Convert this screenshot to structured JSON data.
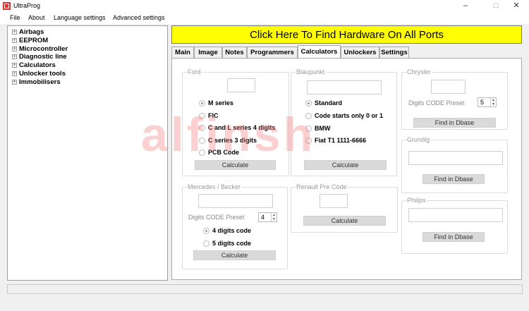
{
  "window": {
    "title": "UltraProg"
  },
  "window_controls": {
    "minimize": "–",
    "maximize": "☐",
    "close": "✕"
  },
  "menu": [
    "File",
    "About",
    "Language settings",
    "Advanced settings"
  ],
  "tree": [
    "Airbags",
    "EEPROM",
    "Microcontroller",
    "Diagnostic line",
    "Calculators",
    "Unlocker tools",
    "Immobilisers"
  ],
  "tree_expander": "+",
  "banner": "Click Here To Find Hardware On All Ports",
  "tabs": [
    "Main",
    "Image",
    "Notes",
    "Programmers",
    "Calculators",
    "Unlockers",
    "Settings"
  ],
  "active_tab": "Calculators",
  "ford": {
    "title": "Ford",
    "options": [
      "M series",
      "FIC",
      "C and L series 4 digits",
      "C series 3 digits",
      "PCB Code"
    ],
    "selected": "M series",
    "button": "Calculate"
  },
  "blaupunkt": {
    "title": "Blaupunkt",
    "options": [
      "Standard",
      "Code starts only 0 or 1",
      "BMW",
      "Fiat T1 1111-6666"
    ],
    "selected": "Standard",
    "button": "Calculate"
  },
  "chrysler": {
    "title": "Chrysler",
    "preset_label": "Digits CODE Preset",
    "preset_value": "5",
    "button": "Find in Dbase"
  },
  "grundig": {
    "title": "Grundig",
    "button": "Find in Dbase"
  },
  "philips": {
    "title": "Philips",
    "button": "Find in Dbase"
  },
  "mercedes": {
    "title": "Mercedes / Becker",
    "preset_label": "Digits CODE Preset",
    "preset_value": "4",
    "options": [
      "4 digits code",
      "5 digits code"
    ],
    "selected": "4 digits code",
    "button": "Calculate"
  },
  "renault": {
    "title": "Renault Pre Code",
    "button": "Calculate"
  },
  "watermark": "alfinsh"
}
